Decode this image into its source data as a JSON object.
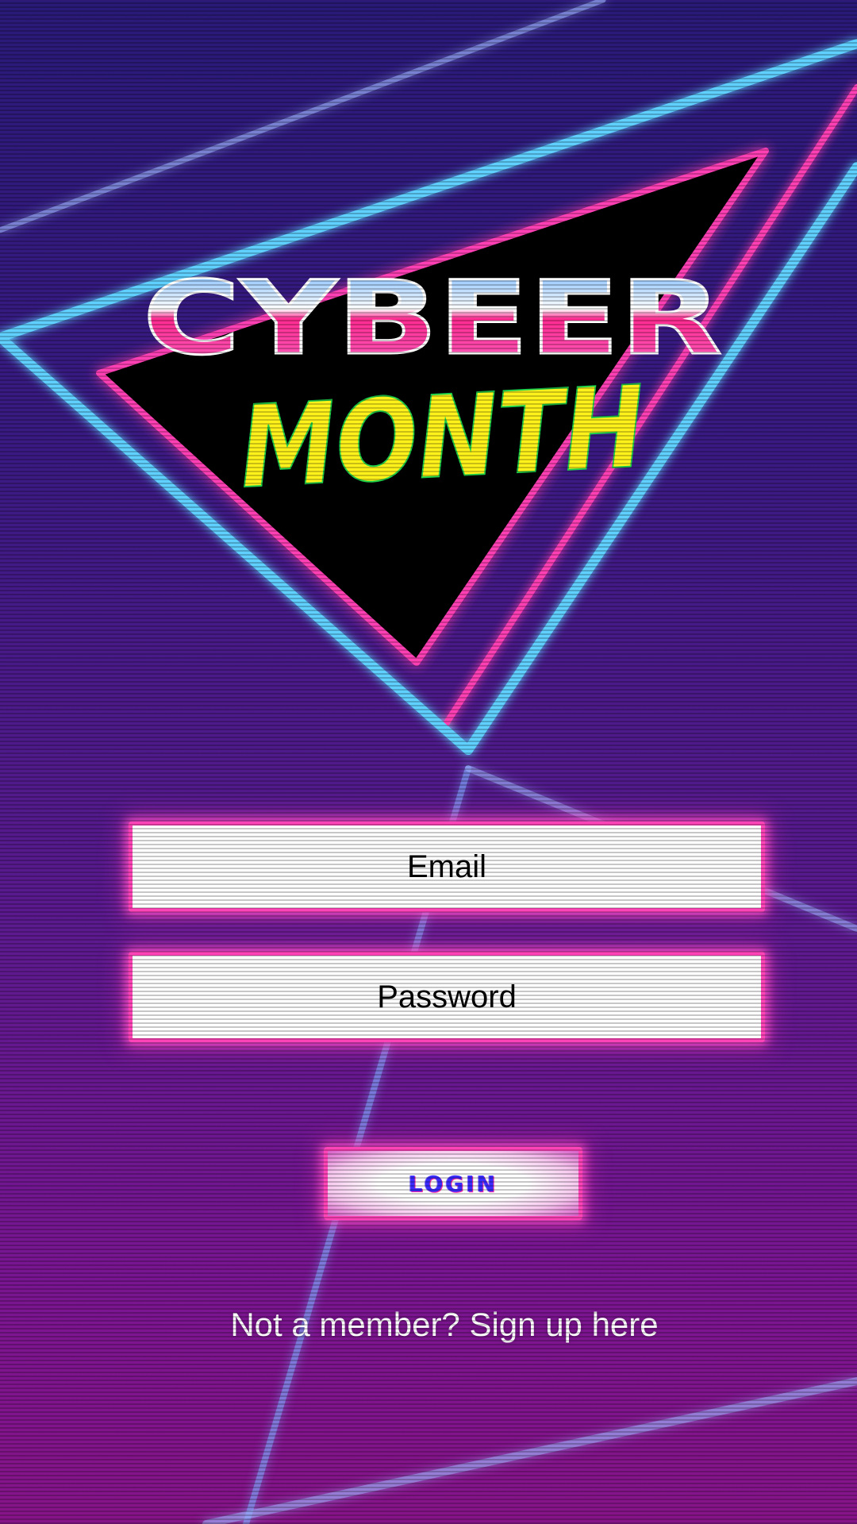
{
  "logo": {
    "line1": "CYBEER",
    "line2": "MONTH"
  },
  "form": {
    "email_placeholder": "Email",
    "password_placeholder": "Password",
    "login_label": "LOGIN"
  },
  "footer": {
    "signup_text": "Not a member? Sign up here"
  },
  "colors": {
    "background_top": "#2a1a78",
    "background_bottom": "#861488",
    "neon_blue": "#5fd0ff",
    "neon_pink": "#ff44b8",
    "logo_yellow": "#fff21a",
    "login_text": "#3a2cff"
  }
}
